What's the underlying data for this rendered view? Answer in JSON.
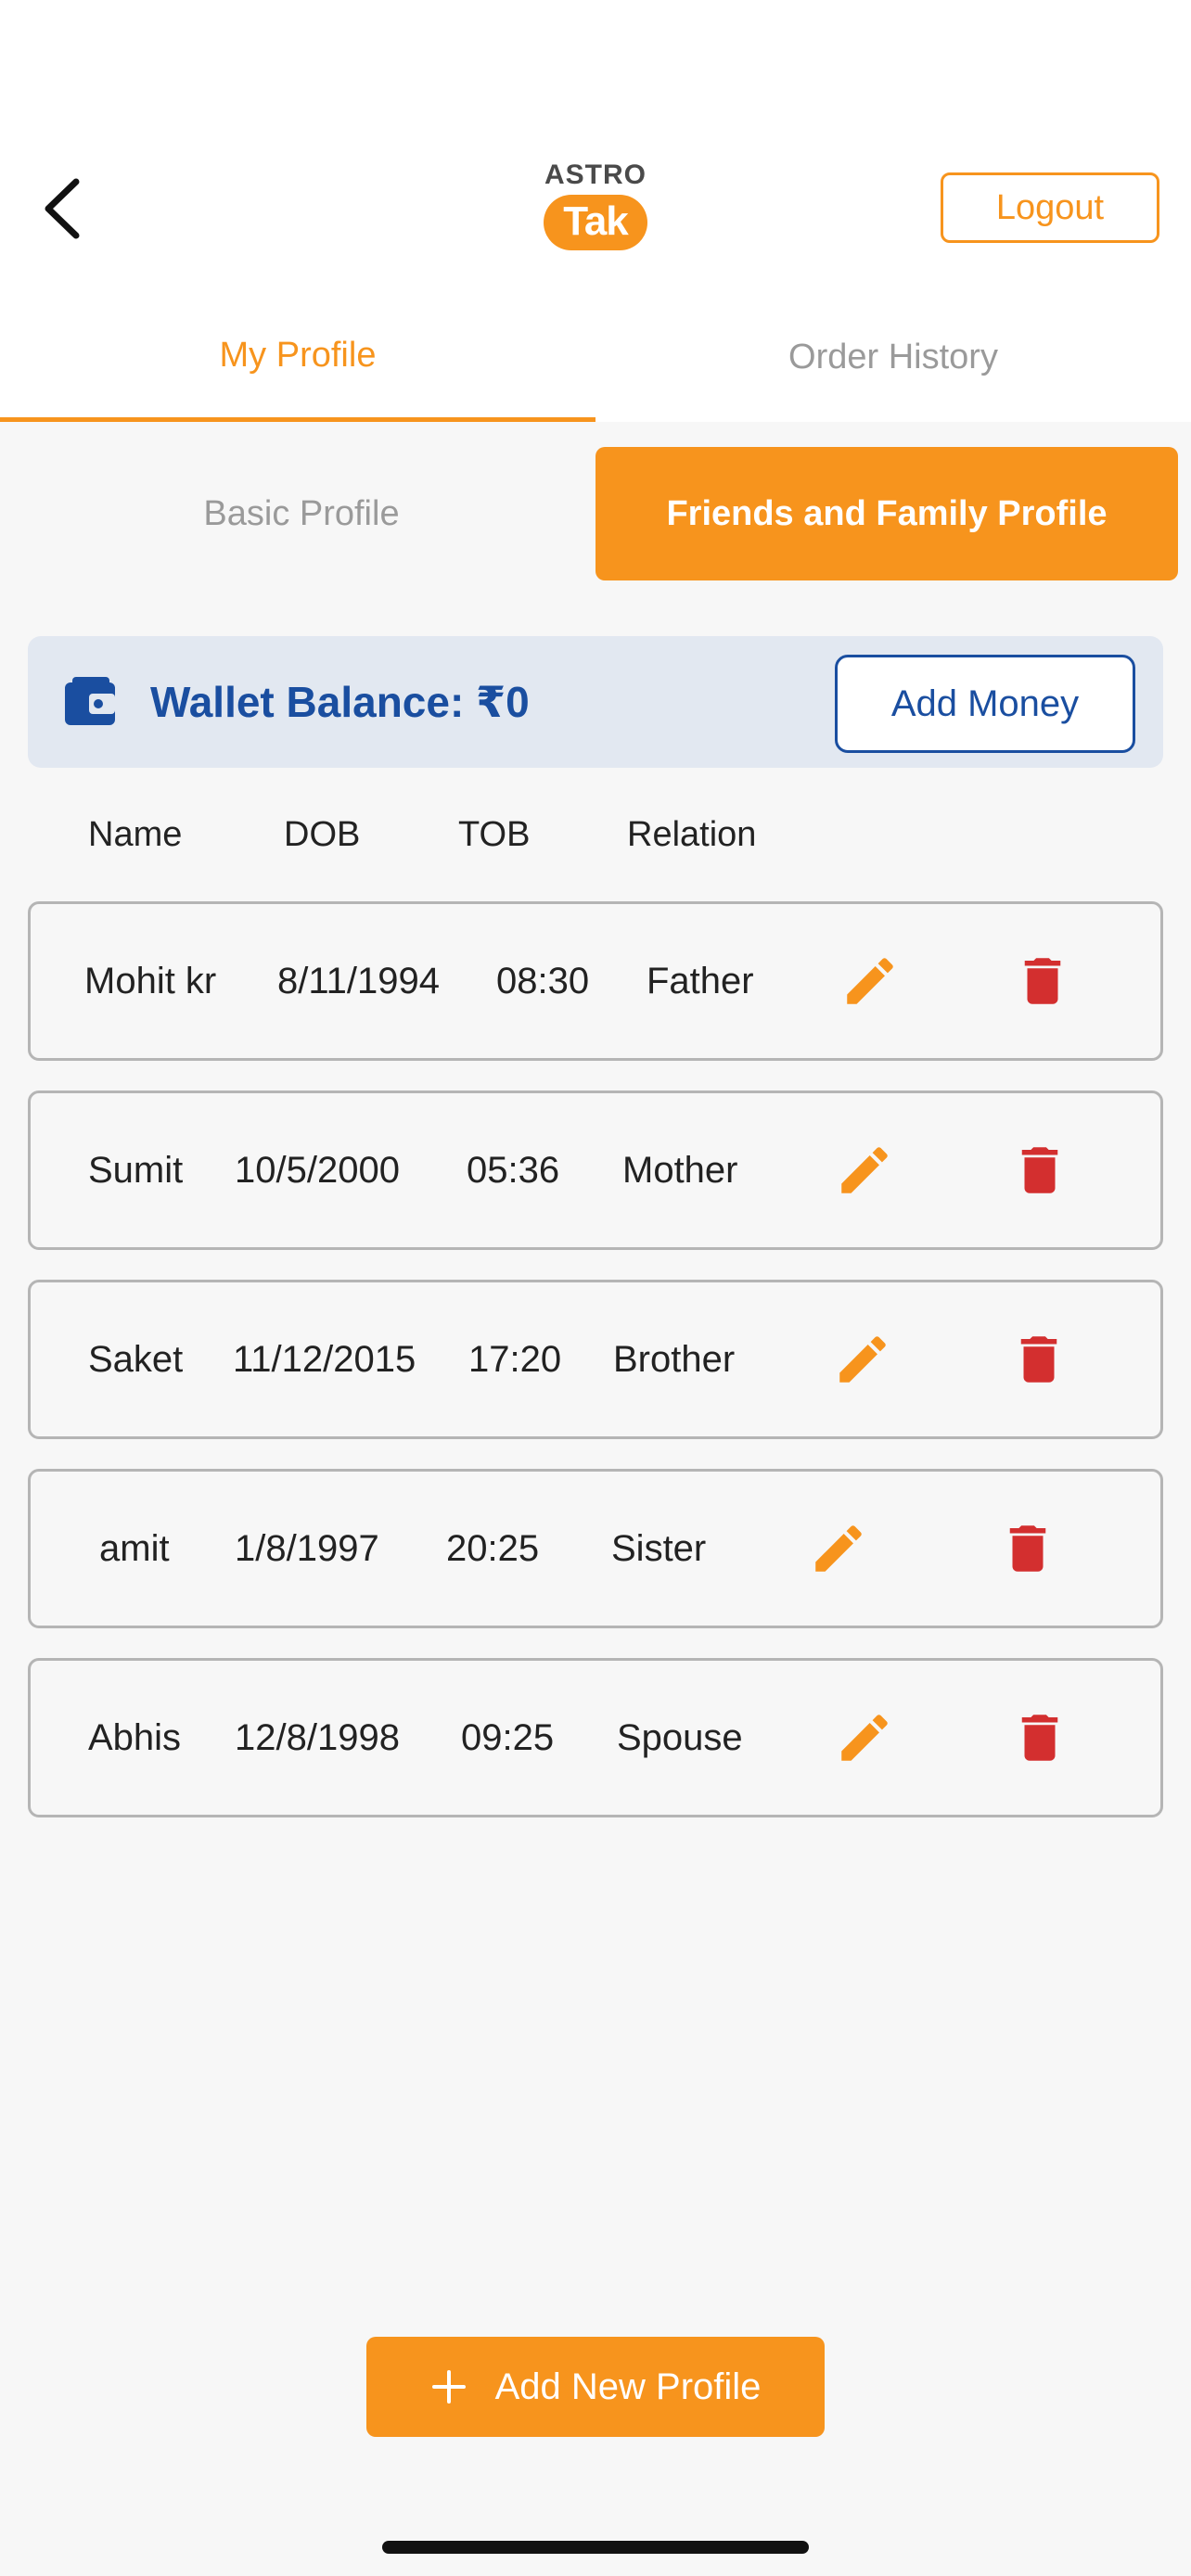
{
  "header": {
    "logo_top": "ASTRO",
    "logo_bottom": "Tak",
    "logout_label": "Logout"
  },
  "tabs": [
    {
      "label": "My Profile",
      "active": true
    },
    {
      "label": "Order History",
      "active": false
    }
  ],
  "segments": [
    {
      "label": "Basic Profile",
      "active": false
    },
    {
      "label": "Friends and Family Profile",
      "active": true
    }
  ],
  "wallet": {
    "balance_text": "Wallet Balance: ₹0",
    "add_money_label": "Add Money"
  },
  "table": {
    "columns": [
      "Name",
      "DOB",
      "TOB",
      "Relation"
    ],
    "rows": [
      {
        "name": "Mohit kr",
        "dob": "8/11/1994",
        "tob": "08:30",
        "relation": "Father"
      },
      {
        "name": "Sumit",
        "dob": "10/5/2000",
        "tob": "05:36",
        "relation": "Mother"
      },
      {
        "name": "Saket",
        "dob": "11/12/2015",
        "tob": "17:20",
        "relation": "Brother"
      },
      {
        "name": "amit",
        "dob": "1/8/1997",
        "tob": "20:25",
        "relation": "Sister"
      },
      {
        "name": "Abhis",
        "dob": "12/8/1998",
        "tob": "09:25",
        "relation": "Spouse"
      }
    ],
    "row_icons": {
      "edit": "pencil-icon",
      "delete": "trash-icon"
    }
  },
  "add_profile_label": "Add New Profile",
  "colors": {
    "accent": "#f7941d",
    "wallet_text": "#1a4ea0",
    "wallet_bg": "#e2e8f1",
    "delete": "#d32f2f",
    "muted": "#9a9a9a"
  }
}
